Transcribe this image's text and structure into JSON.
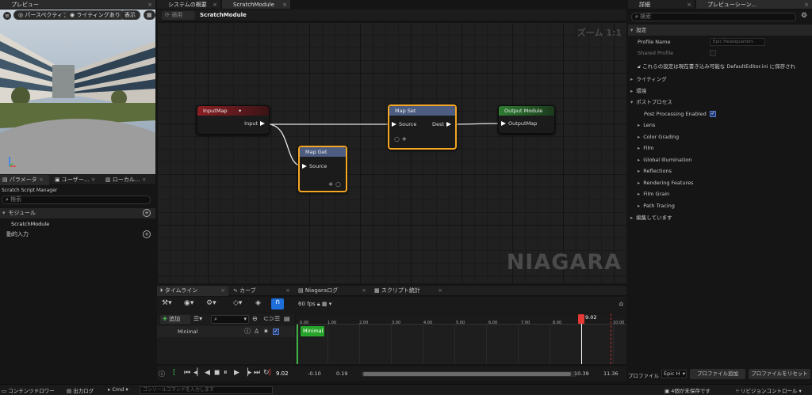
{
  "preview": {
    "tab": "プレビュー",
    "perspective": "パースペクティブ",
    "lighting": "ライティングあり",
    "show": "表示"
  },
  "params": {
    "tabs": [
      "パラメータ",
      "ユーザー...",
      "ローカル..."
    ],
    "manager": "Scratch Script Manager",
    "search_placeholder": "検索",
    "module_section": "モジュール",
    "module_item": "ScratchModule",
    "dynamic_inputs": "動的入力"
  },
  "editor": {
    "tabs": [
      "システムの概要",
      "ScratchModule"
    ],
    "apply": "適用",
    "title": "ScratchModule",
    "zoom": "ズーム 1:1",
    "watermark": "NIAGARA",
    "nodes": {
      "inputmap": {
        "title": "InputMap",
        "out": "Input"
      },
      "mapget": {
        "title": "Map Get",
        "in": "Source"
      },
      "mapset": {
        "title": "Map Set",
        "in": "Source",
        "out": "Dest"
      },
      "output": {
        "title": "Output Module",
        "in": "OutputMap"
      }
    }
  },
  "timeline": {
    "tabs": [
      "タイムライン",
      "カーブ",
      "Niagaraログ",
      "スクリプト統計"
    ],
    "fps": "60 fps",
    "add": "追加",
    "track": "Minimal",
    "clip": "Minimal",
    "ticks": [
      "0.00",
      "1.00",
      "2.00",
      "3.00",
      "4.00",
      "5.00",
      "6.00",
      "7.00",
      "8.00",
      "10.00"
    ],
    "playhead": "9.02",
    "current_time": "9.02",
    "range_start": "-0.10",
    "range_in": "0.19",
    "range_end1": "10.39",
    "range_end2": "11.36"
  },
  "details": {
    "tabs": [
      "詳細",
      "プレビューシーン..."
    ],
    "search_placeholder": "検索",
    "settings_section": "設定",
    "profile_name_label": "Profile Name",
    "profile_name_value": "Epic Headquarters",
    "shared_profile_label": "Shared Profile",
    "info_text": "これらの設定は現在書き込み可能な DefaultEditor.ini に保存され",
    "sections": [
      {
        "label": "ライティング",
        "expanded": false
      },
      {
        "label": "環境",
        "expanded": false
      },
      {
        "label": "ポストプロセス",
        "expanded": true
      }
    ],
    "post_processing_label": "Post Processing Enabled",
    "subsections": [
      "Lens",
      "Color Grading",
      "Film",
      "Global Illumination",
      "Reflections",
      "Rendering Features",
      "Film Grain",
      "Path Tracing"
    ],
    "editing": "編集しています",
    "profile_label": "プロファイル",
    "profile_select": "Epic H",
    "add_profile": "プロファイル追加",
    "reset_profile": "プロファイルをリセット"
  },
  "statusbar": {
    "content_drawer": "コンテンツドロワー",
    "output_log": "出力ログ",
    "cmd": "Cmd",
    "console_placeholder": "コンソールコマンドを入力します",
    "unsaved": "4個が未保存です",
    "revision": "リビジョンコントロール"
  },
  "colors": {
    "accent_orange": "#f5a623",
    "inputmap_header": "#8a1f24",
    "output_header": "#2e7d32",
    "mapset_header": "#4d5d82",
    "clip_green": "#27a52a",
    "playhead_red": "#e53935"
  }
}
